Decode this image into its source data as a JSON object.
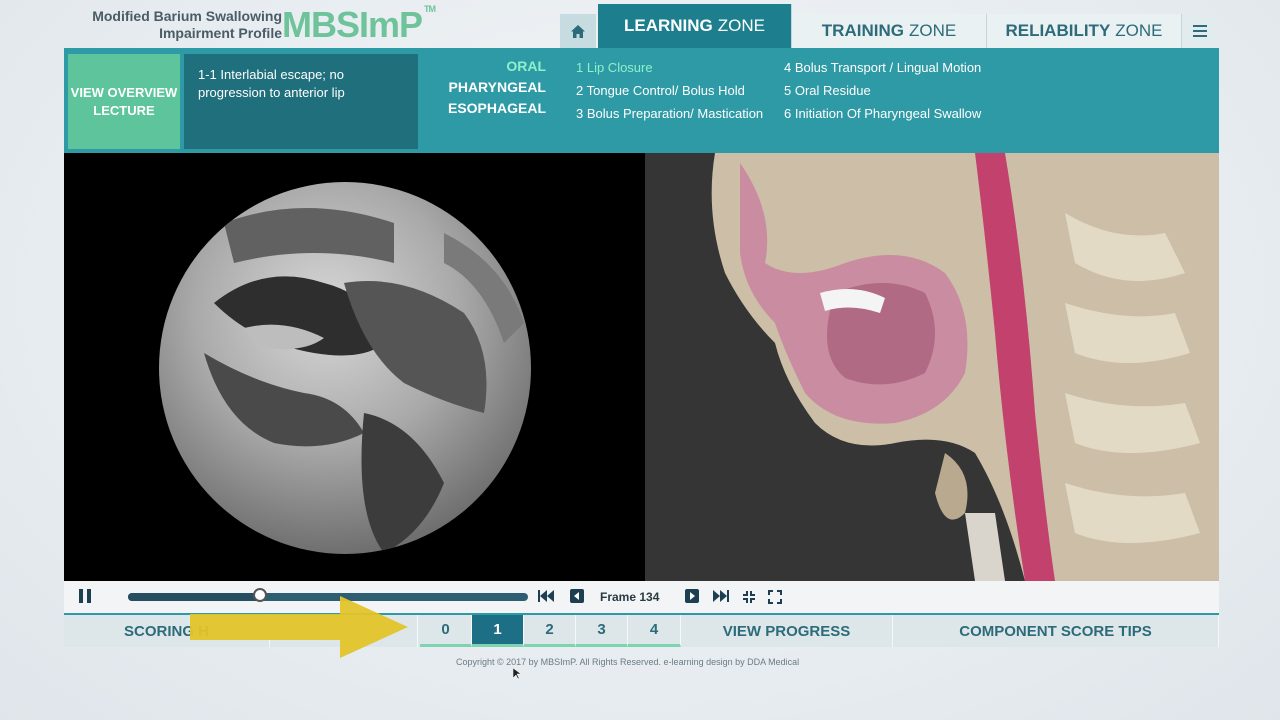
{
  "brand": {
    "subtitle_line1": "Modified Barium Swallowing",
    "subtitle_line2": "Impairment Profile",
    "logo": "MBSImP",
    "tm": "TM"
  },
  "nav": {
    "home_icon": "home-icon",
    "tabs": [
      {
        "label": "LEARNING",
        "suffix": "ZONE"
      },
      {
        "label": "TRAINING",
        "suffix": "ZONE"
      },
      {
        "label": "RELIABILITY",
        "suffix": "ZONE"
      }
    ],
    "menu_icon": "hamburger-menu-icon"
  },
  "info": {
    "overview_button": "VIEW OVERVIEW LECTURE",
    "description": "1-1 Interlabial escape; no progression to anterior lip",
    "categories": [
      "ORAL",
      "PHARYNGEAL",
      "ESOPHAGEAL"
    ],
    "components_left": [
      "1 Lip Closure",
      "2 Tongue Control/ Bolus Hold",
      "3 Bolus Preparation/ Mastication"
    ],
    "components_right": [
      "4 Bolus Transport / Lingual Motion",
      "5 Oral Residue",
      "6 Initiation Of Pharyngeal Swallow"
    ]
  },
  "controls": {
    "frame_label": "Frame 134",
    "progress": 0.33
  },
  "scoring": {
    "label": "SCORING H",
    "scores": [
      "0",
      "1",
      "2",
      "3",
      "4"
    ],
    "selected": "1",
    "view_progress": "VIEW PROGRESS",
    "tips": "COMPONENT SCORE TIPS"
  },
  "footer": {
    "copyright": "Copyright © 2017 by MBSImP. All Rights Reserved. e-learning design by DDA Medical"
  },
  "colors": {
    "teal": "#2e9aa6",
    "dark_teal": "#1d7f8e",
    "green": "#5ec49c",
    "highlight": "#8ff0c8",
    "arrow": "#e3c42a"
  }
}
